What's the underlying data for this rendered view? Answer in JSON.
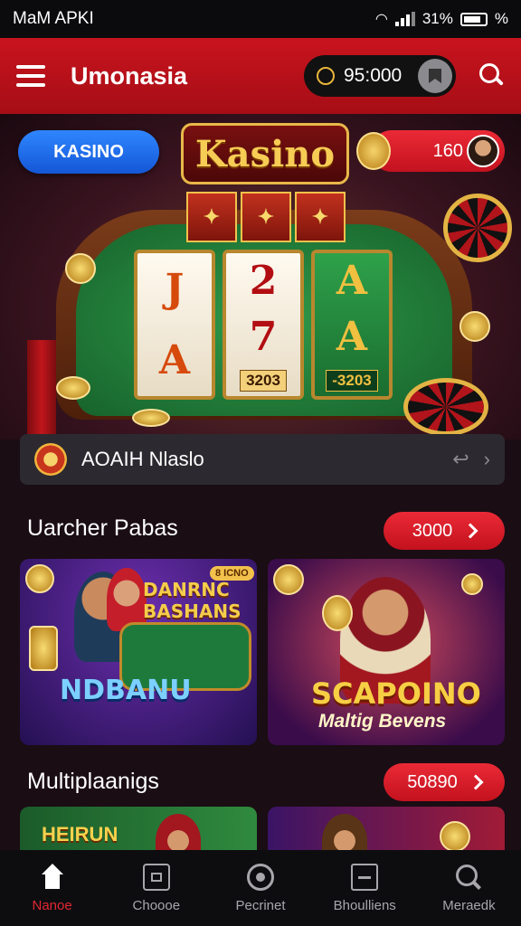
{
  "status_bar": {
    "carrier": "MaM APKI",
    "battery": "31%",
    "extra": "%"
  },
  "header": {
    "title": "Umonasia",
    "balance": "95:000"
  },
  "hero": {
    "kasino_button": "KASINO",
    "logo": "Kasino",
    "user_amount": "160",
    "badges": [
      "✦",
      "✦",
      "✦"
    ],
    "reels": [
      {
        "top": "J",
        "mid": "A",
        "num": ""
      },
      {
        "top": "2",
        "mid": "7",
        "num": "3203"
      },
      {
        "top": "A",
        "mid": "A",
        "num": "-3203"
      }
    ]
  },
  "promo": {
    "text": "AOAIH Nlaslo",
    "prev": "↩",
    "next": "›"
  },
  "sections": [
    {
      "title": "Uarcher Pabas",
      "button": "3000"
    },
    {
      "title": "Multiplaanigs",
      "button": "50890"
    }
  ],
  "cards": {
    "c1_top": "DANRNC BASHANS",
    "c1_tag": "8 ICNO",
    "c1_bottom": "NDBANU",
    "c2_title": "SCAPOINO",
    "c2_sub": "Maltig Bevens",
    "c3_title": "HEIRUN"
  },
  "nav": [
    {
      "label": "Nanoe",
      "icon": "home-icon"
    },
    {
      "label": "Choooe",
      "icon": "box-icon"
    },
    {
      "label": "Pecrinet",
      "icon": "target-icon"
    },
    {
      "label": "Bhoulliens",
      "icon": "document-icon"
    },
    {
      "label": "Meraedk",
      "icon": "search-icon"
    }
  ],
  "colors": {
    "brand_red": "#c8141e",
    "accent_blue": "#2f86ff",
    "gold": "#f4cd4a"
  }
}
